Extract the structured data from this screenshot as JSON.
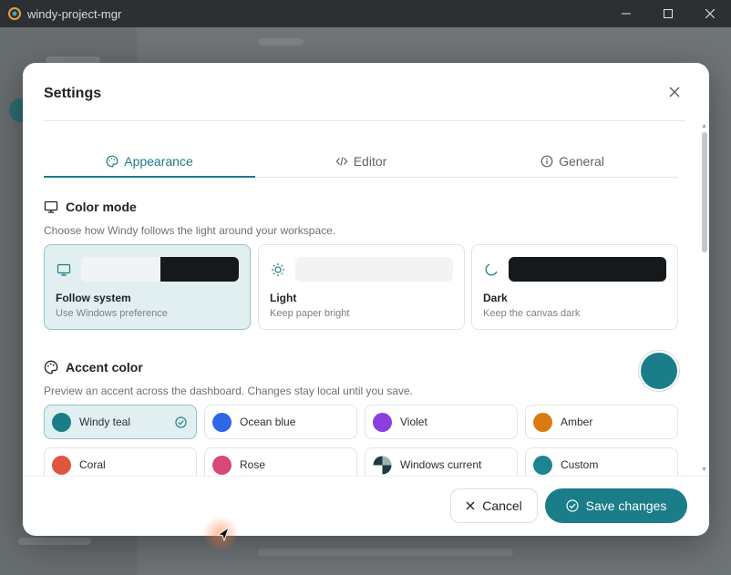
{
  "window": {
    "title": "windy-project-mgr",
    "controls": {
      "minimize": "—",
      "maximize": "☐",
      "close": "✕"
    }
  },
  "settings": {
    "title": "Settings",
    "tabs": [
      {
        "label": "Appearance",
        "icon": "palette-icon",
        "active": true
      },
      {
        "label": "Editor",
        "icon": "code-icon",
        "active": false
      },
      {
        "label": "General",
        "icon": "info-icon",
        "active": false
      }
    ],
    "color_mode": {
      "title": "Color mode",
      "description": "Choose how Windy follows the light around your workspace.",
      "options": [
        {
          "name": "Follow system",
          "subtitle": "Use Windows preference",
          "icon": "monitor-icon",
          "selected": true
        },
        {
          "name": "Light",
          "subtitle": "Keep paper bright",
          "icon": "sun-icon",
          "selected": false
        },
        {
          "name": "Dark",
          "subtitle": "Keep the canvas dark",
          "icon": "moon-icon",
          "selected": false
        }
      ]
    },
    "accent": {
      "title": "Accent color",
      "description": "Preview an accent across the dashboard. Changes stay local until you save.",
      "current_color": "#1a7d88",
      "swatches": [
        {
          "label": "Windy teal",
          "color": "#1a7d88",
          "selected": true
        },
        {
          "label": "Ocean blue",
          "color": "#2f66e8",
          "selected": false
        },
        {
          "label": "Violet",
          "color": "#8b3fe0",
          "selected": false
        },
        {
          "label": "Amber",
          "color": "#dc7a12",
          "selected": false
        },
        {
          "label": "Coral",
          "color": "#e0553f",
          "selected": false
        },
        {
          "label": "Rose",
          "color": "#d8467a",
          "selected": false
        },
        {
          "label": "Windows current",
          "color": "#1f3a40",
          "selected": false
        },
        {
          "label": "Custom",
          "color": "#1b8593",
          "selected": false
        }
      ]
    },
    "footer": {
      "cancel_label": "Cancel",
      "save_label": "Save changes"
    }
  }
}
